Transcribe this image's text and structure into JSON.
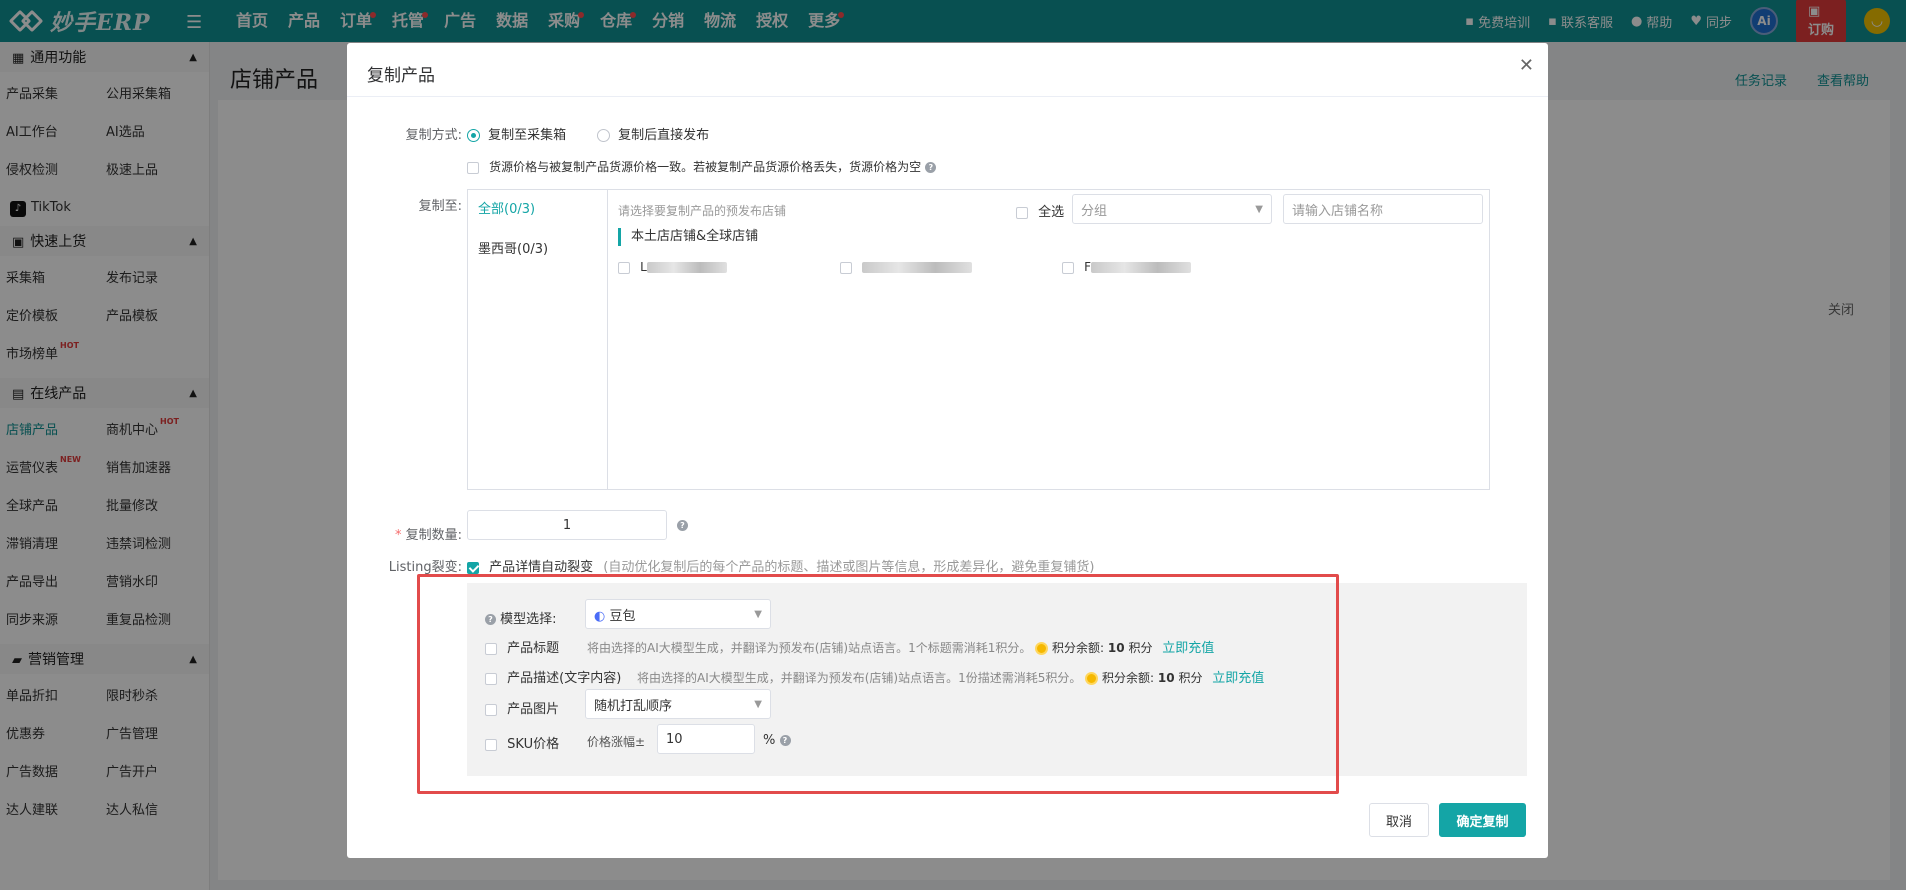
{
  "topbar": {
    "logo_text": "妙手ERP",
    "nav": [
      "首页",
      "产品",
      "订单",
      "托管",
      "广告",
      "数据",
      "采购",
      "仓库",
      "分销",
      "物流",
      "授权",
      "更多"
    ],
    "nav_dots": [
      false,
      false,
      true,
      true,
      false,
      false,
      true,
      true,
      false,
      false,
      false,
      true
    ],
    "free_training": "免费培训",
    "contact": "联系客服",
    "help": "帮助",
    "sync": "同步",
    "ai_badge": "Ai",
    "order": "订购"
  },
  "sidebar": {
    "sections": [
      {
        "title": "通用功能",
        "items": [
          "产品采集",
          "公用采集箱",
          "AI工作台",
          "AI选品",
          "侵权检测",
          "极速上品"
        ],
        "extra": "TikTok"
      },
      {
        "title": "快速上货",
        "items": [
          "采集箱",
          "发布记录",
          "定价模板",
          "产品模板",
          "市场榜单"
        ]
      },
      {
        "title": "在线产品",
        "items": [
          "店铺产品",
          "商机中心",
          "运营仪表",
          "销售加速器",
          "全球产品",
          "批量修改",
          "滞销清理",
          "违禁词检测",
          "产品导出",
          "营销水印",
          "同步来源",
          "重复品检测"
        ]
      },
      {
        "title": "营销管理",
        "items": [
          "单品折扣",
          "限时秒杀",
          "优惠券",
          "广告管理",
          "广告数据",
          "广告开户",
          "达人建联",
          "达人私信"
        ]
      }
    ],
    "tags": {
      "hot": "HOT",
      "new": "NEW"
    }
  },
  "page": {
    "title": "店铺产品",
    "task_record": "任务记录",
    "help": "查看帮助",
    "close": "关闭"
  },
  "modal": {
    "title": "复制产品",
    "copy_method_label": "复制方式:",
    "copy_to_box": "复制至采集箱",
    "copy_publish": "复制后直接发布",
    "source_price_note": "货源价格与被复制产品货源价格一致。若被复制产品货源价格丢失，货源价格为空",
    "copy_to_label": "复制至:",
    "store_tabs": [
      "全部(0/3)",
      "墨西哥(0/3)"
    ],
    "store_placeholder": "请选择要复制产品的预发布店铺",
    "select_all": "全选",
    "group_placeholder": "分组",
    "store_name_placeholder": "请输入店铺名称",
    "store_group": "本土店店铺&全球店铺",
    "store_prefixes": [
      "L",
      "",
      "F"
    ],
    "copy_count_label": "复制数量:",
    "copy_count": "1",
    "listing_label": "Listing裂变:",
    "listing_check": "产品详情自动裂变",
    "listing_note": "(自动优化复制后的每个产品的标题、描述或图片等信息，形成差异化，避免重复铺货)",
    "model_label": "模型选择:",
    "model_value": "豆包",
    "title_opt": "产品标题",
    "title_note": "将由选择的AI大模型生成，并翻译为预发布(店铺)站点语言。1个标题需消耗1积分。",
    "desc_opt": "产品描述(文字内容)",
    "desc_note": "将由选择的AI大模型生成，并翻译为预发布(店铺)站点语言。1份描述需消耗5积分。",
    "balance_label": "积分余额:",
    "balance_value": "10",
    "balance_unit": "积分",
    "recharge": "立即充值",
    "image_opt": "产品图片",
    "image_value": "随机打乱顺序",
    "sku_opt": "SKU价格",
    "price_range": "价格涨幅±",
    "price_value": "10",
    "percent": "%",
    "cancel": "取消",
    "confirm": "确定复制"
  }
}
